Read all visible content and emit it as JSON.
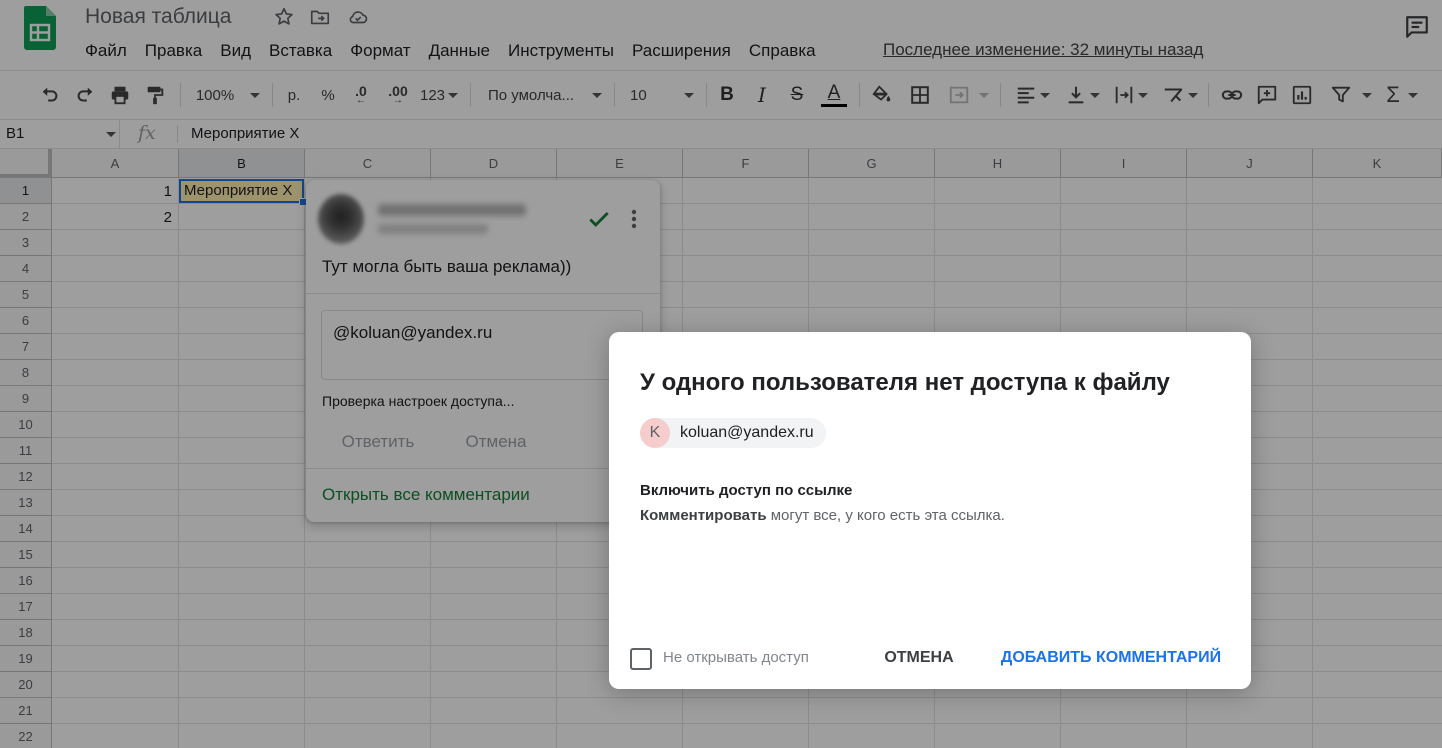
{
  "app": {
    "doc_title": "Новая таблица",
    "last_edit": "Последнее изменение: 32 минуты назад",
    "brand_color": "#0f9d58"
  },
  "menu": [
    "Файл",
    "Правка",
    "Вид",
    "Вставка",
    "Формат",
    "Данные",
    "Инструменты",
    "Расширения",
    "Справка"
  ],
  "toolbar": {
    "zoom": "100%",
    "currency": "р.",
    "percent": "%",
    "decrease_decimal": ".0",
    "increase_decimal": ".00",
    "more_formats": "123",
    "font": "По умолча...",
    "font_size": "10",
    "bold": "B",
    "italic": "I",
    "strike": "S",
    "text_color": "A",
    "sum": "Σ"
  },
  "formula_bar": {
    "cell_ref": "B1",
    "fx": "fx",
    "value": "Мероприятие Х"
  },
  "grid": {
    "columns": [
      "A",
      "B",
      "C",
      "D",
      "E",
      "F",
      "G",
      "H",
      "I",
      "J",
      "K"
    ],
    "rows": [
      "1",
      "2",
      "3",
      "4",
      "5",
      "6",
      "7",
      "8",
      "9",
      "10",
      "11",
      "12",
      "13",
      "14",
      "15",
      "16",
      "17",
      "18",
      "19",
      "20",
      "21",
      "22"
    ],
    "cells": {
      "a1": "1",
      "a2": "2",
      "b1": "Мероприятие Х"
    }
  },
  "comment": {
    "text": "Тут могла быть ваша реклама))",
    "reply_value": "@koluan@yandex.ru",
    "access_check": "Проверка настроек доступа...",
    "reply_label": "Ответить",
    "cancel_label": "Отмена",
    "open_all_label": "Открыть все комментарии"
  },
  "dialog": {
    "title": "У одного пользователя нет доступа к файлу",
    "user_initial": "K",
    "user_email": "koluan@yandex.ru",
    "link_title": "Включить доступ по ссылке",
    "link_desc_bold": "Комментировать",
    "link_desc_rest": " могут все, у кого есть эта ссылка.",
    "no_share_label": "Не открывать доступ",
    "cancel_label": "ОТМЕНА",
    "add_label": "ДОБАВИТЬ КОММЕНТАРИЙ",
    "accent_color": "#1a73e8"
  }
}
